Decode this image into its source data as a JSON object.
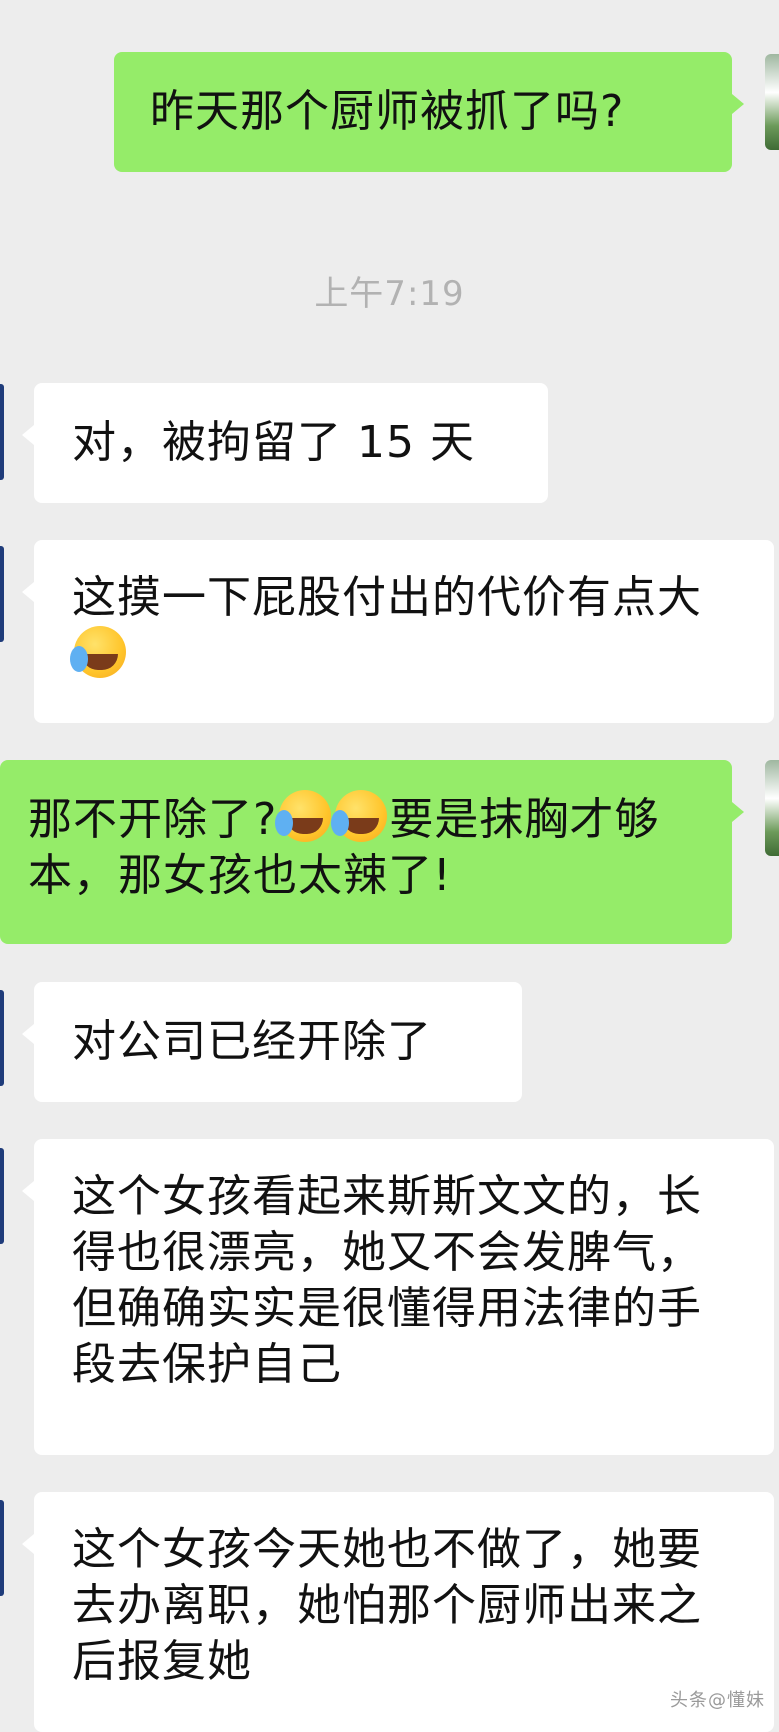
{
  "messages": [
    {
      "direction": "out",
      "text": "昨天那个厨师被抓了吗?"
    },
    {
      "direction": "in",
      "text": "对，被拘留了 15 天"
    },
    {
      "direction": "in",
      "text": "这摸一下屁股付出的代价有点大",
      "emoji_after": "face-with-tears-of-joy-emoji"
    },
    {
      "direction": "out",
      "text_before": "那不开除了?",
      "emoji_count": 2,
      "text_after": "要是抹胸才够本，那女孩也太辣了!"
    },
    {
      "direction": "in",
      "text": "对公司已经开除了"
    },
    {
      "direction": "in",
      "text": "这个女孩看起来斯斯文文的，长得也很漂亮，她又不会发脾气，但确确实实是很懂得用法律的手段去保护自己"
    },
    {
      "direction": "in",
      "text": "这个女孩今天她也不做了，她要去办离职，她怕那个厨师出来之后报复她"
    }
  ],
  "timestamp": "上午7:19",
  "watermark": "头条@懂妹",
  "colors": {
    "outgoing_bubble": "#95ec69",
    "incoming_bubble": "#ffffff",
    "background": "#ededed",
    "timestamp": "#b2b2b2"
  }
}
